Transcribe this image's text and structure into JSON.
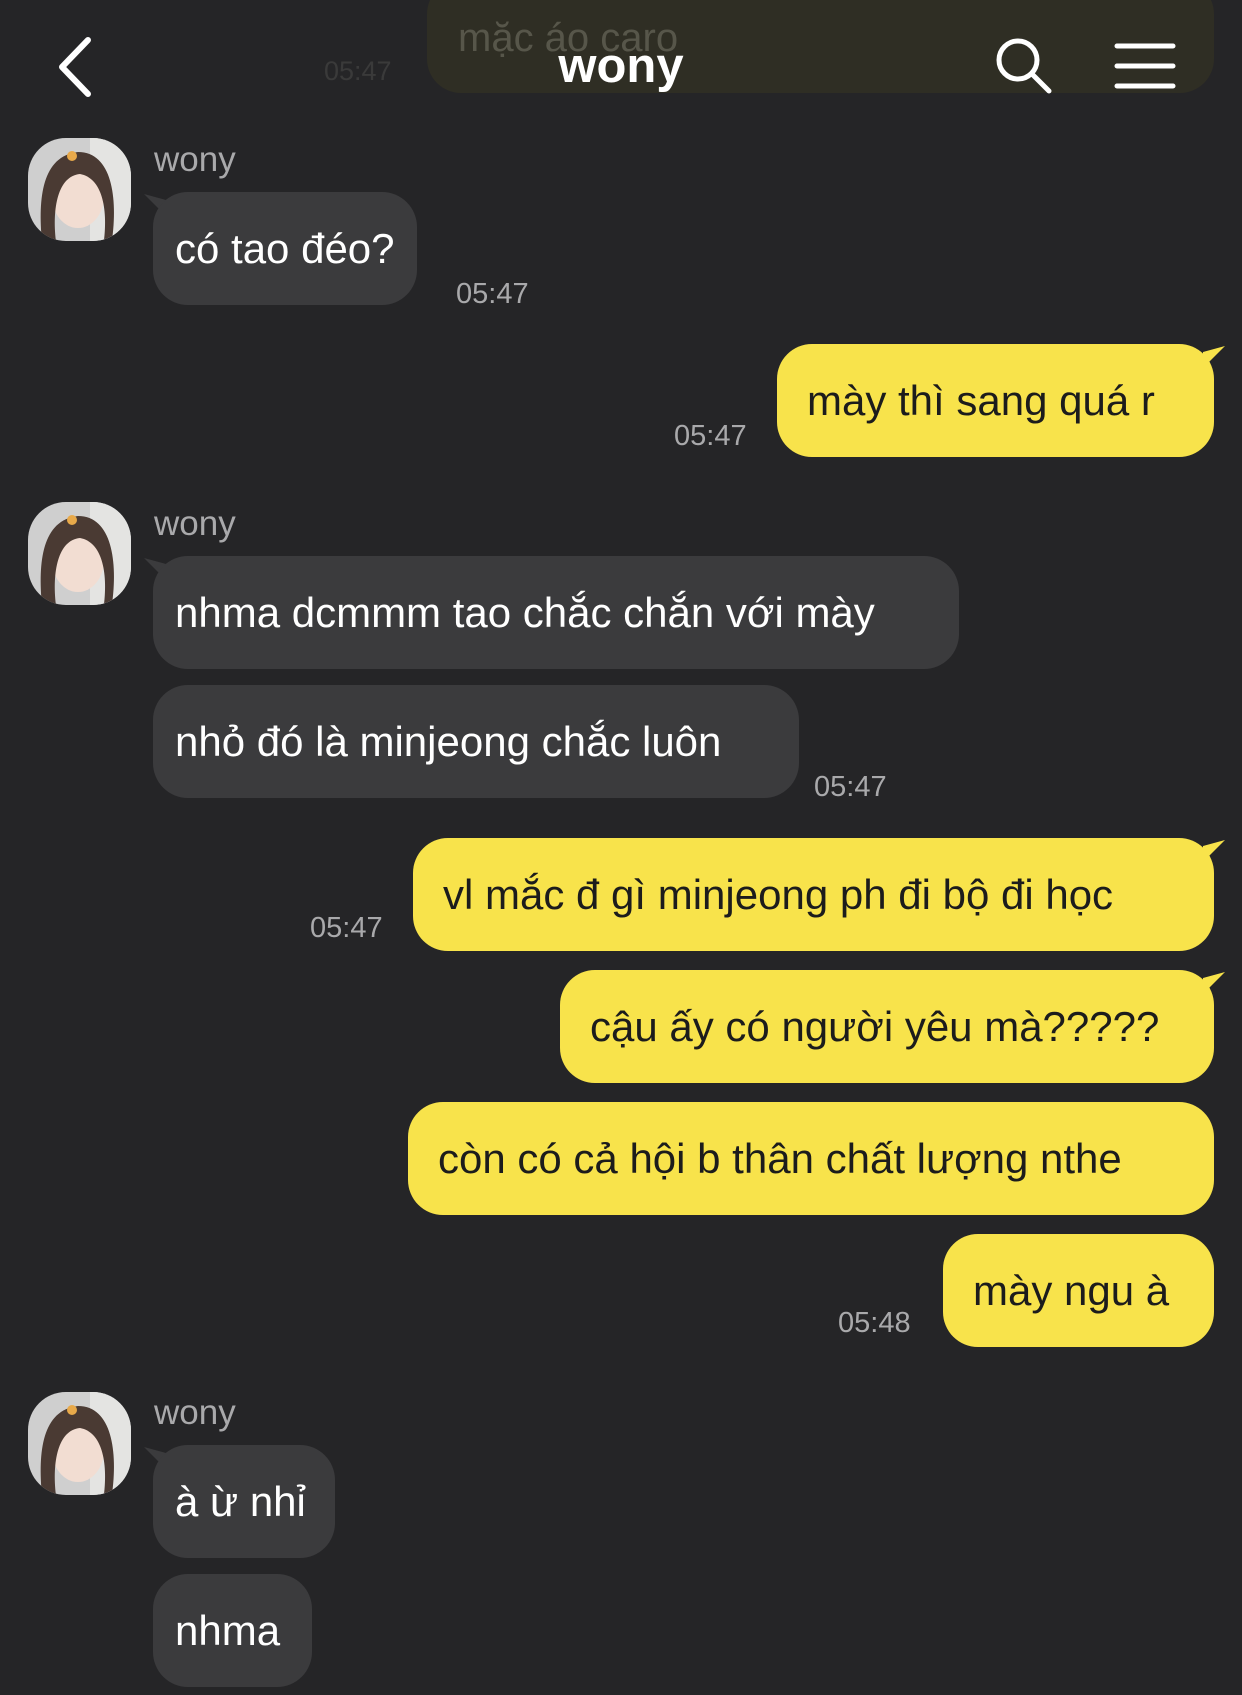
{
  "header": {
    "title": "wony",
    "prev_message_text": "mặc áo caro",
    "prev_message_time": "05:47"
  },
  "messages": [
    {
      "sender": "wony",
      "text": "có tao đéo?",
      "time": "05:47"
    },
    {
      "text": "mày thì sang quá r",
      "time": "05:47"
    },
    {
      "sender": "wony",
      "text": "nhma dcmmm tao chắc chắn với mày"
    },
    {
      "text": "nhỏ đó là minjeong chắc luôn",
      "time": "05:47"
    },
    {
      "text": "vl mắc đ gì minjeong ph đi bộ đi học",
      "time": "05:47"
    },
    {
      "text": "cậu ấy có người yêu mà?????"
    },
    {
      "text": "còn có cả hội b thân chất lượng nthe"
    },
    {
      "text": "mày ngu à",
      "time": "05:48"
    },
    {
      "sender": "wony",
      "text": "à ừ nhỉ"
    },
    {
      "text": "nhma"
    }
  ],
  "colors": {
    "background": "#252527",
    "incoming_bubble": "#3b3b3d",
    "outgoing_bubble": "#f8e34b",
    "timestamp": "#a9a9ab"
  }
}
